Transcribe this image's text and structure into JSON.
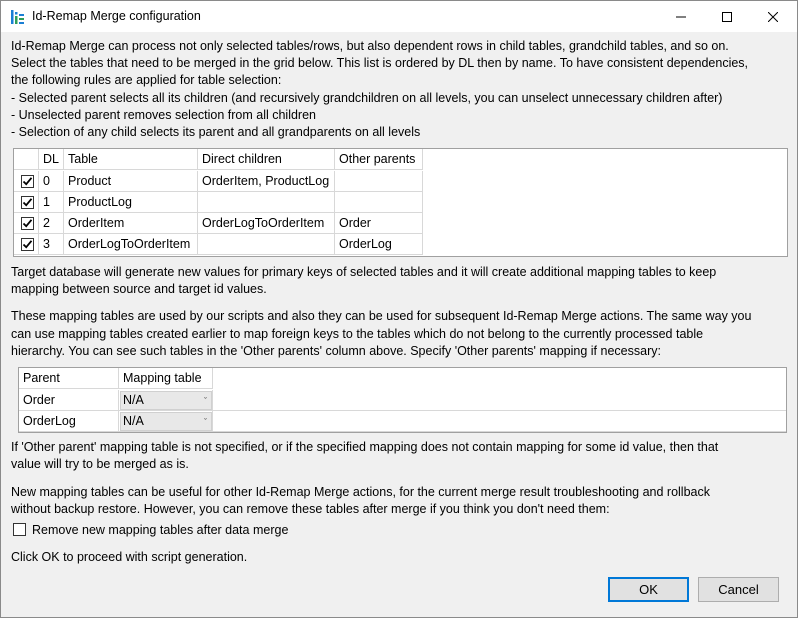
{
  "window": {
    "title": "Id-Remap Merge configuration",
    "app_icon": "id-remap-app-icon",
    "controls": {
      "minimize_icon": "minimize-icon",
      "maximize_icon": "maximize-icon",
      "close_icon": "close-icon"
    }
  },
  "intro_lines": [
    "Id-Remap Merge can process not only selected tables/rows, but also dependent rows in child tables, grandchild tables, and so on.",
    "Select the tables that need to be merged in the grid below. This list is ordered by DL then by name. To have consistent dependencies,",
    "the following rules are applied for table selection:",
    "- Selected parent selects all its children (and recursively grandchildren on all levels, you can unselect unnecessary children after)",
    "- Unselected parent removes selection from all children",
    "- Selection of any child selects its parent and all grandparents on all levels"
  ],
  "tables_grid": {
    "columns": [
      "DL",
      "Table",
      "Direct children",
      "Other parents"
    ],
    "rows": [
      {
        "checked": true,
        "dl": "0",
        "table": "Product",
        "children": "OrderItem, ProductLog",
        "parents": ""
      },
      {
        "checked": true,
        "dl": "1",
        "table": "ProductLog",
        "children": "",
        "parents": ""
      },
      {
        "checked": true,
        "dl": "2",
        "table": "OrderItem",
        "children": "OrderLogToOrderItem",
        "parents": "Order"
      },
      {
        "checked": true,
        "dl": "3",
        "table": "OrderLogToOrderItem",
        "children": "",
        "parents": "OrderLog"
      }
    ]
  },
  "target_lines": [
    "Target database will generate new values for primary keys of selected tables and it will create additional mapping tables to keep",
    "mapping between source and target id values."
  ],
  "mapping_lines": [
    "These mapping tables are used by our scripts and also they can be used for subsequent Id-Remap Merge actions. The same way you",
    "can use mapping tables created earlier to map foreign keys to the tables which do not belong to the currently processed table",
    "hierarchy. You can see such tables in the 'Other parents' column above. Specify 'Other parents' mapping if necessary:"
  ],
  "mapping_grid": {
    "columns": [
      "Parent",
      "Mapping table"
    ],
    "rows": [
      {
        "parent": "Order",
        "mapping": "N/A"
      },
      {
        "parent": "OrderLog",
        "mapping": "N/A"
      }
    ]
  },
  "other_parent_lines": [
    "If 'Other parent' mapping table is not specified, or if the specified mapping does not contain mapping for some id value, then that",
    "value will try to be merged as is."
  ],
  "new_mapping_lines": [
    "New mapping tables can be useful for other Id-Remap Merge actions, for the current merge result troubleshooting and rollback",
    "without backup restore. However, you can remove these tables after merge if you think you don't need them:"
  ],
  "remove_checkbox": {
    "label": "Remove new mapping tables after data merge",
    "checked": false
  },
  "footer_text": "Click OK to proceed with script generation.",
  "buttons": {
    "ok": "OK",
    "cancel": "Cancel"
  }
}
